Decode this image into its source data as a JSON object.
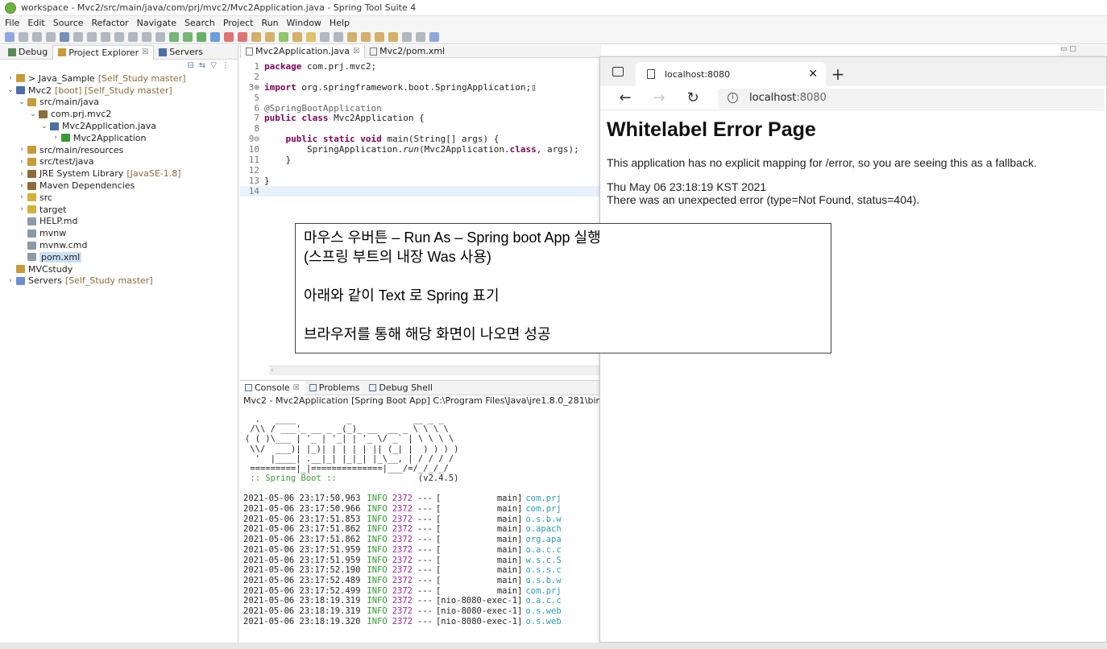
{
  "window": {
    "title": "workspace - Mvc2/src/main/java/com/prj/mvc2/Mvc2Application.java - Spring Tool Suite 4"
  },
  "menubar": [
    "File",
    "Edit",
    "Source",
    "Refactor",
    "Navigate",
    "Search",
    "Project",
    "Run",
    "Window",
    "Help"
  ],
  "left_panel": {
    "tabs": [
      {
        "label": "Debug",
        "icon": "debug-icon"
      },
      {
        "label": "Project Explorer",
        "icon": "project-explorer-icon",
        "active": true
      },
      {
        "label": "Servers",
        "icon": "servers-icon"
      }
    ],
    "tree": [
      {
        "label": "> Java_Sample",
        "deco": "[Self_Study master]",
        "indent": 0,
        "arrow": ">",
        "icon": "project-icon"
      },
      {
        "label": "Mvc2",
        "deco": "[boot] [Self_Study master]",
        "indent": 0,
        "arrow": "v",
        "icon": "boot-project-icon"
      },
      {
        "label": "src/main/java",
        "deco": "",
        "indent": 1,
        "arrow": "v",
        "icon": "source-folder-icon"
      },
      {
        "label": "com.prj.mvc2",
        "deco": "",
        "indent": 2,
        "arrow": "v",
        "icon": "package-icon"
      },
      {
        "label": "Mvc2Application.java",
        "deco": "",
        "indent": 3,
        "arrow": "v",
        "icon": "java-file-icon"
      },
      {
        "label": "Mvc2Application",
        "deco": "",
        "indent": 4,
        "arrow": ">",
        "icon": "class-icon"
      },
      {
        "label": "src/main/resources",
        "deco": "",
        "indent": 1,
        "arrow": ">",
        "icon": "source-folder-icon"
      },
      {
        "label": "src/test/java",
        "deco": "",
        "indent": 1,
        "arrow": ">",
        "icon": "source-folder-icon"
      },
      {
        "label": "JRE System Library",
        "deco": "[JavaSE-1.8]",
        "indent": 1,
        "arrow": ">",
        "icon": "library-icon"
      },
      {
        "label": "Maven Dependencies",
        "deco": "",
        "indent": 1,
        "arrow": ">",
        "icon": "library-icon"
      },
      {
        "label": "src",
        "deco": "",
        "indent": 1,
        "arrow": ">",
        "icon": "folder-icon"
      },
      {
        "label": "target",
        "deco": "",
        "indent": 1,
        "arrow": ">",
        "icon": "folder-icon"
      },
      {
        "label": "HELP.md",
        "deco": "",
        "indent": 1,
        "arrow": "",
        "icon": "file-icon"
      },
      {
        "label": "mvnw",
        "deco": "",
        "indent": 1,
        "arrow": "",
        "icon": "file-icon"
      },
      {
        "label": "mvnw.cmd",
        "deco": "",
        "indent": 1,
        "arrow": "",
        "icon": "file-icon"
      },
      {
        "label": "pom.xml",
        "deco": "",
        "indent": 1,
        "arrow": "",
        "icon": "xml-file-icon",
        "selected": true
      },
      {
        "label": "MVCstudy",
        "deco": "",
        "indent": 0,
        "arrow": "",
        "icon": "project-icon"
      },
      {
        "label": "Servers",
        "deco": "[Self_Study master]",
        "indent": 0,
        "arrow": ">",
        "icon": "servers-icon"
      }
    ]
  },
  "editor": {
    "tabs": [
      {
        "label": "Mvc2Application.java",
        "active": true
      },
      {
        "label": "Mvc2/pom.xml",
        "active": false
      }
    ],
    "lines": [
      {
        "n": "1",
        "html": "<span class='kw'>package</span> com.prj.mvc2;"
      },
      {
        "n": "2",
        "html": ""
      },
      {
        "n": "3⊕",
        "html": "<span class='kw'>import</span> org.springframework.boot.SpringApplication;▯"
      },
      {
        "n": "5",
        "html": ""
      },
      {
        "n": "6",
        "html": "<span class='ann'>@SpringBootApplication</span>"
      },
      {
        "n": "7",
        "html": "<span class='kw'>public class</span> Mvc2Application {"
      },
      {
        "n": "8",
        "html": ""
      },
      {
        "n": "9⊖",
        "html": "    <span class='kw'>public static void</span> main(String[] args) {"
      },
      {
        "n": "10",
        "html": "        SpringApplication.<span class='fld'>run</span>(Mvc2Application.<span class='kw'>class</span>, args);"
      },
      {
        "n": "11",
        "html": "    }"
      },
      {
        "n": "12",
        "html": ""
      },
      {
        "n": "13",
        "html": "}"
      },
      {
        "n": "14",
        "html": "",
        "current": true
      }
    ]
  },
  "console": {
    "tabs": [
      {
        "label": "Console",
        "active": true
      },
      {
        "label": "Problems",
        "active": false
      },
      {
        "label": "Debug Shell",
        "active": false
      }
    ],
    "header": "Mvc2 - Mvc2Application [Spring Boot App] C:\\Program Files\\Java\\jre1.8.0_281\\bin",
    "banner": "  .   ____          _            __ _ _\n /\\\\ / ___'_ __ _ _(_)_ __  __ _ \\ \\ \\ \\\n( ( )\\___ | '_ | '_| | '_ \\/ _` | \\ \\ \\ \\\n \\\\/  ___)| |_)| | | | | || (_| |  ) ) ) )\n  '  |____| .__|_| |_|_| |_\\__, | / / / /\n =========|_|==============|___/=/_/_/_/",
    "banner_label": " :: Spring Boot :: ",
    "banner_version": "               (v2.4.5)",
    "logs": [
      {
        "ts": "2021-05-06 23:17:50.963",
        "level": "INFO",
        "pid": "2372",
        "sep": "---",
        "thread": "[           main]",
        "logger": "com.prj"
      },
      {
        "ts": "2021-05-06 23:17:50.966",
        "level": "INFO",
        "pid": "2372",
        "sep": "---",
        "thread": "[           main]",
        "logger": "com.prj"
      },
      {
        "ts": "2021-05-06 23:17:51.853",
        "level": "INFO",
        "pid": "2372",
        "sep": "---",
        "thread": "[           main]",
        "logger": "o.s.b.w"
      },
      {
        "ts": "2021-05-06 23:17:51.862",
        "level": "INFO",
        "pid": "2372",
        "sep": "---",
        "thread": "[           main]",
        "logger": "o.apach"
      },
      {
        "ts": "2021-05-06 23:17:51.862",
        "level": "INFO",
        "pid": "2372",
        "sep": "---",
        "thread": "[           main]",
        "logger": "org.apa"
      },
      {
        "ts": "2021-05-06 23:17:51.959",
        "level": "INFO",
        "pid": "2372",
        "sep": "---",
        "thread": "[           main]",
        "logger": "o.a.c.c"
      },
      {
        "ts": "2021-05-06 23:17:51.959",
        "level": "INFO",
        "pid": "2372",
        "sep": "---",
        "thread": "[           main]",
        "logger": "w.s.c.S"
      },
      {
        "ts": "2021-05-06 23:17:52.190",
        "level": "INFO",
        "pid": "2372",
        "sep": "---",
        "thread": "[           main]",
        "logger": "o.s.s.c"
      },
      {
        "ts": "2021-05-06 23:17:52.489",
        "level": "INFO",
        "pid": "2372",
        "sep": "---",
        "thread": "[           main]",
        "logger": "o.s.b.w"
      },
      {
        "ts": "2021-05-06 23:17:52.499",
        "level": "INFO",
        "pid": "2372",
        "sep": "---",
        "thread": "[           main]",
        "logger": "com.prj"
      },
      {
        "ts": "2021-05-06 23:18:19.319",
        "level": "INFO",
        "pid": "2372",
        "sep": "---",
        "thread": "[nio-8080-exec-1]",
        "logger": "o.a.c.c"
      },
      {
        "ts": "2021-05-06 23:18:19.319",
        "level": "INFO",
        "pid": "2372",
        "sep": "---",
        "thread": "[nio-8080-exec-1]",
        "logger": "o.s.web"
      },
      {
        "ts": "2021-05-06 23:18:19.320",
        "level": "INFO",
        "pid": "2372",
        "sep": "---",
        "thread": "[nio-8080-exec-1]",
        "logger": "o.s.web"
      }
    ]
  },
  "browser": {
    "tab_title": "localhost:8080",
    "url_host": "localhost",
    "url_port": ":8080",
    "page": {
      "heading": "Whitelabel Error Page",
      "message": "This application has no explicit mapping for /error, so you are seeing this as a fallback.",
      "timestamp": "Thu May 06 23:18:19 KST 2021",
      "error": "There was an unexpected error (type=Not Found, status=404)."
    }
  },
  "note": {
    "line1": "마우스 우버튼 – Run As – Spring boot App 실행",
    "line2": "(스프링 부트의 내장 Was 사용)",
    "line3": "아래와 같이 Text 로 Spring 표기",
    "line4": "브라우저를 통해 해당 화면이 나오면 성공"
  },
  "colors": {
    "keyword": "#7f0055",
    "info": "#2e9b2e",
    "pid": "#a020a0",
    "logger": "#2aa0b0",
    "spring_green": "#6db33f"
  }
}
